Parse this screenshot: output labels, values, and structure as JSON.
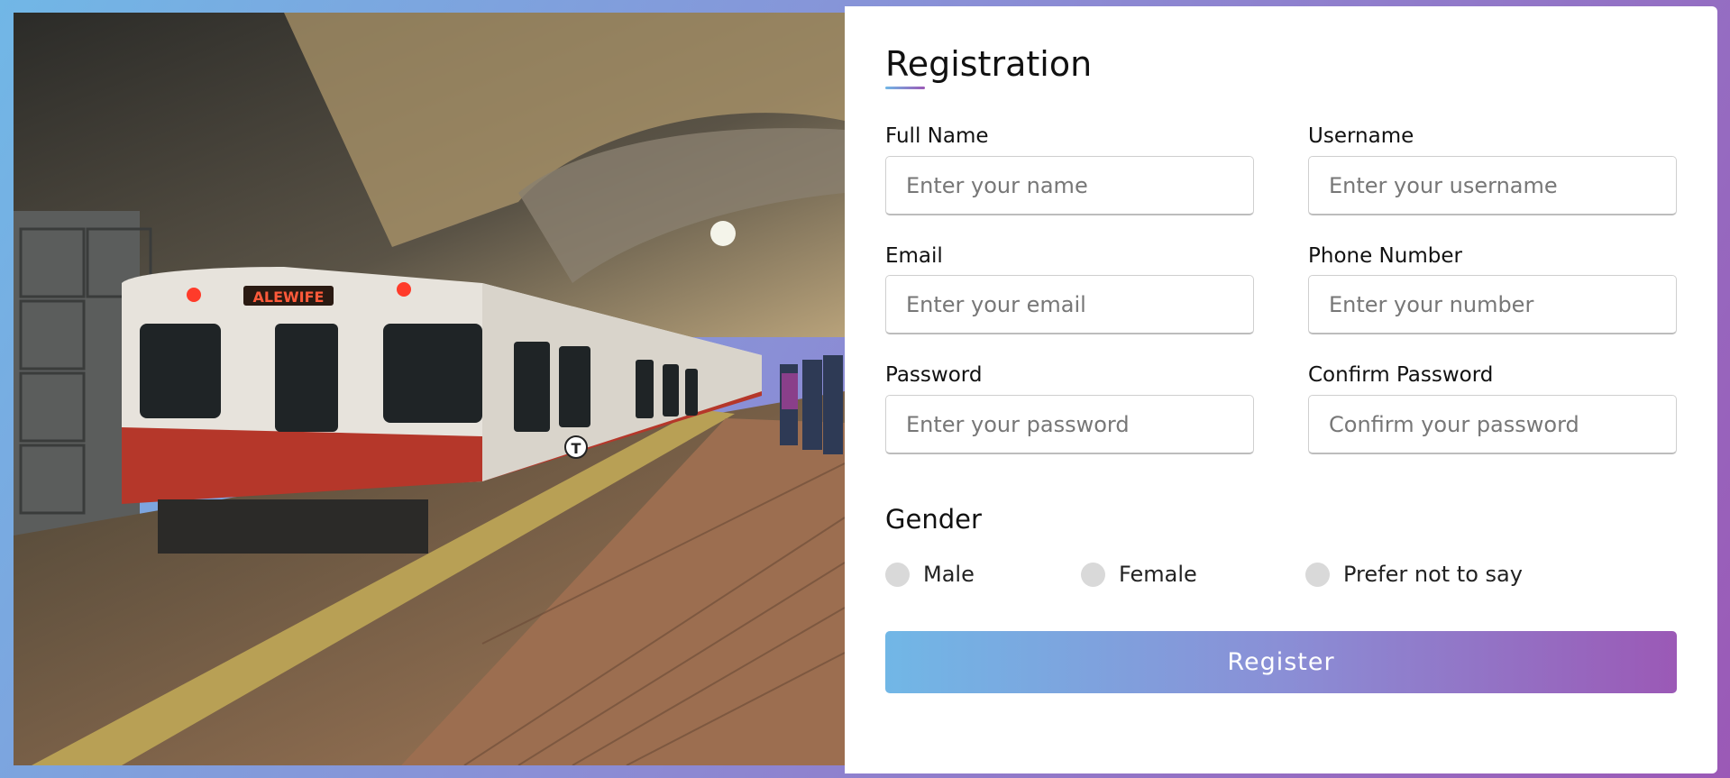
{
  "form": {
    "title": "Registration",
    "fields": [
      {
        "label": "Full Name",
        "placeholder": "Enter your name"
      },
      {
        "label": "Username",
        "placeholder": "Enter your username"
      },
      {
        "label": "Email",
        "placeholder": "Enter your email"
      },
      {
        "label": "Phone Number",
        "placeholder": "Enter your number"
      },
      {
        "label": "Password",
        "placeholder": "Enter your password"
      },
      {
        "label": "Confirm Password",
        "placeholder": "Confirm your password"
      }
    ],
    "gender": {
      "title": "Gender",
      "options": [
        "Male",
        "Female",
        "Prefer not to say"
      ]
    },
    "register_label": "Register"
  },
  "photo": {
    "train_sign": "ALEWIFE",
    "logo_letter": "T"
  },
  "colors": {
    "gradient_start": "#71b7e6",
    "gradient_end": "#9b59b6"
  }
}
